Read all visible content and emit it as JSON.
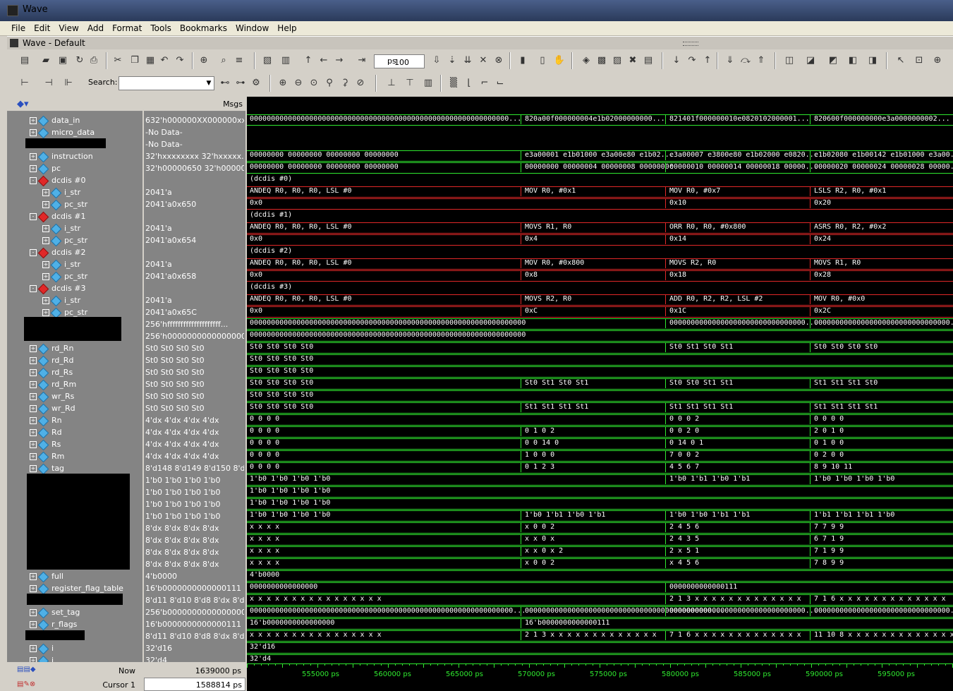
{
  "window": {
    "title": "Wave",
    "subtitle": "Wave - Default"
  },
  "menu": [
    "File",
    "Edit",
    "View",
    "Add",
    "Format",
    "Tools",
    "Bookmarks",
    "Window",
    "Help"
  ],
  "toolbar": {
    "zoom_value": "100",
    "zoom_unit": "ps",
    "search_label": "Search:"
  },
  "header": {
    "msgs": "Msgs"
  },
  "signals": [
    {
      "name": "data_in",
      "value": "632'h000000XX000000xx...",
      "icon": "blue",
      "exp": "+",
      "indent": 0
    },
    {
      "name": "micro_data",
      "value": "-No Data-",
      "icon": "blue",
      "exp": "+",
      "indent": 0
    },
    {
      "name": "",
      "value": "-No Data-",
      "icon": "",
      "exp": "",
      "indent": 0
    },
    {
      "name": "instruction",
      "value": "32'hxxxxxxxx 32'hxxxxx...",
      "icon": "blue",
      "exp": "+",
      "indent": 0
    },
    {
      "name": "pc",
      "value": "32'h00000650 32'h00000...",
      "icon": "blue",
      "exp": "+",
      "indent": 0
    },
    {
      "name": "dcdis #0",
      "value": "",
      "icon": "red",
      "exp": "-",
      "indent": 0
    },
    {
      "name": "i_str",
      "value": "2041'a",
      "icon": "blue",
      "exp": "+",
      "indent": 1
    },
    {
      "name": "pc_str",
      "value": "2041'a0x650",
      "icon": "blue",
      "exp": "+",
      "indent": 1
    },
    {
      "name": "dcdis #1",
      "value": "",
      "icon": "red",
      "exp": "-",
      "indent": 0
    },
    {
      "name": "i_str",
      "value": "2041'a",
      "icon": "blue",
      "exp": "+",
      "indent": 1
    },
    {
      "name": "pc_str",
      "value": "2041'a0x654",
      "icon": "blue",
      "exp": "+",
      "indent": 1
    },
    {
      "name": "dcdis #2",
      "value": "",
      "icon": "red",
      "exp": "-",
      "indent": 0
    },
    {
      "name": "i_str",
      "value": "2041'a",
      "icon": "blue",
      "exp": "+",
      "indent": 1
    },
    {
      "name": "pc_str",
      "value": "2041'a0x658",
      "icon": "blue",
      "exp": "+",
      "indent": 1
    },
    {
      "name": "dcdis #3",
      "value": "",
      "icon": "red",
      "exp": "-",
      "indent": 0
    },
    {
      "name": "i_str",
      "value": "2041'a",
      "icon": "blue",
      "exp": "+",
      "indent": 1
    },
    {
      "name": "pc_str",
      "value": "2041'a0x65C",
      "icon": "blue",
      "exp": "+",
      "indent": 1
    },
    {
      "name": "",
      "value": "256'hffffffffffffffffffff...",
      "icon": "",
      "exp": "",
      "indent": 0
    },
    {
      "name": "",
      "value": "256'h00000000000000000...",
      "icon": "",
      "exp": "",
      "indent": 0
    },
    {
      "name": "rd_Rn",
      "value": "St0 St0 St0 St0",
      "icon": "blue",
      "exp": "+",
      "indent": 0
    },
    {
      "name": "rd_Rd",
      "value": "St0 St0 St0 St0",
      "icon": "blue",
      "exp": "+",
      "indent": 0
    },
    {
      "name": "rd_Rs",
      "value": "St0 St0 St0 St0",
      "icon": "blue",
      "exp": "+",
      "indent": 0
    },
    {
      "name": "rd_Rm",
      "value": "St0 St0 St0 St0",
      "icon": "blue",
      "exp": "+",
      "indent": 0
    },
    {
      "name": "wr_Rs",
      "value": "St0 St0 St0 St0",
      "icon": "blue",
      "exp": "+",
      "indent": 0
    },
    {
      "name": "wr_Rd",
      "value": "St0 St0 St0 St0",
      "icon": "blue",
      "exp": "+",
      "indent": 0
    },
    {
      "name": "Rn",
      "value": "4'dx 4'dx 4'dx 4'dx",
      "icon": "blue",
      "exp": "+",
      "indent": 0
    },
    {
      "name": "Rd",
      "value": "4'dx 4'dx 4'dx 4'dx",
      "icon": "blue",
      "exp": "+",
      "indent": 0
    },
    {
      "name": "Rs",
      "value": "4'dx 4'dx 4'dx 4'dx",
      "icon": "blue",
      "exp": "+",
      "indent": 0
    },
    {
      "name": "Rm",
      "value": "4'dx 4'dx 4'dx 4'dx",
      "icon": "blue",
      "exp": "+",
      "indent": 0
    },
    {
      "name": "tag",
      "value": "8'd148 8'd149 8'd150 8'd151",
      "icon": "blue",
      "exp": "+",
      "indent": 0
    },
    {
      "name": "",
      "value": "1'b0 1'b0 1'b0 1'b0",
      "icon": "",
      "exp": "",
      "indent": 0
    },
    {
      "name": "",
      "value": "1'b0 1'b0 1'b0 1'b0",
      "icon": "",
      "exp": "",
      "indent": 0
    },
    {
      "name": "",
      "value": "1'b0 1'b0 1'b0 1'b0",
      "icon": "",
      "exp": "",
      "indent": 0
    },
    {
      "name": "",
      "value": "1'b0 1'b0 1'b0 1'b0",
      "icon": "",
      "exp": "",
      "indent": 0
    },
    {
      "name": "",
      "value": "8'dx 8'dx 8'dx 8'dx",
      "icon": "",
      "exp": "",
      "indent": 0
    },
    {
      "name": "",
      "value": "8'dx 8'dx 8'dx 8'dx",
      "icon": "",
      "exp": "",
      "indent": 0
    },
    {
      "name": "",
      "value": "8'dx 8'dx 8'dx 8'dx",
      "icon": "",
      "exp": "",
      "indent": 0
    },
    {
      "name": "",
      "value": "8'dx 8'dx 8'dx 8'dx",
      "icon": "",
      "exp": "",
      "indent": 0
    },
    {
      "name": "full",
      "value": "4'b0000",
      "icon": "blue",
      "exp": "+",
      "indent": 0
    },
    {
      "name": "register_flag_table",
      "value": "16'b0000000000000111",
      "icon": "blue",
      "exp": "+",
      "indent": 0
    },
    {
      "name": "",
      "value": "8'd11 8'd10 8'd8 8'dx 8'dx ...",
      "icon": "",
      "exp": "",
      "indent": 0
    },
    {
      "name": "set_tag",
      "value": "256'b000000000000000000...",
      "icon": "blue",
      "exp": "+",
      "indent": 0
    },
    {
      "name": "r_flags",
      "value": "16'b0000000000000111",
      "icon": "blue",
      "exp": "+",
      "indent": 0
    },
    {
      "name": "",
      "value": "8'd11 8'd10 8'd8 8'dx 8'dx ...",
      "icon": "",
      "exp": "",
      "indent": 0
    },
    {
      "name": "i",
      "value": "32'd16",
      "icon": "blue",
      "exp": "+",
      "indent": 0
    },
    {
      "name": "j",
      "value": "32'd4",
      "icon": "blue",
      "exp": "+",
      "indent": 0
    }
  ],
  "waves": [
    {
      "color": "green",
      "segs": [
        [
          "0000000000000000000000000000000000000000000000000000000000000...",
          0
        ],
        [
          "820a00f000000004e1b02000000000...",
          390
        ],
        [
          "821401f000000010e0820102000001...",
          595
        ],
        [
          "820600f000000000e3a0000000002...",
          800
        ]
      ]
    },
    {
      "color": "green",
      "segs": []
    },
    {
      "color": "green",
      "segs": []
    },
    {
      "color": "green",
      "segs": [
        [
          "00000000 00000000 00000000 00000000",
          0
        ],
        [
          "e3a00001 e1b01000 e3a00e80 e1b02...",
          390
        ],
        [
          "e3a00007 e3800e80 e1b02000 e0820...",
          595
        ],
        [
          "e1b02080 e1b00142 e1b01000 e3a00...",
          800
        ]
      ]
    },
    {
      "color": "green",
      "segs": [
        [
          "00000000 00000000 00000000 00000000",
          0
        ],
        [
          "00000000 00000004 00000008 0000000c",
          390
        ],
        [
          "00000010 00000014 00000018 00000...",
          595
        ],
        [
          "00000020 00000024 00000028 00000...",
          800
        ]
      ]
    },
    {
      "color": "none",
      "segs": [
        [
          "(dcdis #0)",
          0
        ]
      ]
    },
    {
      "color": "red",
      "segs": [
        [
          "ANDEQ R0, R0, R0, LSL #0",
          0
        ],
        [
          "MOV R0, #0x1",
          390
        ],
        [
          "MOV R0, #0x7",
          595
        ],
        [
          "LSLS R2, R0, #0x1",
          800
        ]
      ]
    },
    {
      "color": "red",
      "segs": [
        [
          "0x0",
          0
        ],
        [
          "0x10",
          595
        ],
        [
          "0x20",
          800
        ]
      ]
    },
    {
      "color": "none",
      "segs": [
        [
          "(dcdis #1)",
          0
        ]
      ]
    },
    {
      "color": "red",
      "segs": [
        [
          "ANDEQ R0, R0, R0, LSL #0",
          0
        ],
        [
          "MOVS R1, R0",
          390
        ],
        [
          "ORR R0, R0, #0x800",
          595
        ],
        [
          "ASRS R0, R2, #0x2",
          800
        ]
      ]
    },
    {
      "color": "red",
      "segs": [
        [
          "0x0",
          0
        ],
        [
          "0x4",
          390
        ],
        [
          "0x14",
          595
        ],
        [
          "0x24",
          800
        ]
      ]
    },
    {
      "color": "none",
      "segs": [
        [
          "(dcdis #2)",
          0
        ]
      ]
    },
    {
      "color": "red",
      "segs": [
        [
          "ANDEQ R0, R0, R0, LSL #0",
          0
        ],
        [
          "MOV R0, #0x800",
          390
        ],
        [
          "MOVS R2, R0",
          595
        ],
        [
          "MOVS R1, R0",
          800
        ]
      ]
    },
    {
      "color": "red",
      "segs": [
        [
          "0x0",
          0
        ],
        [
          "0x8",
          390
        ],
        [
          "0x18",
          595
        ],
        [
          "0x28",
          800
        ]
      ]
    },
    {
      "color": "none",
      "segs": [
        [
          "(dcdis #3)",
          0
        ]
      ]
    },
    {
      "color": "red",
      "segs": [
        [
          "ANDEQ R0, R0, R0, LSL #0",
          0
        ],
        [
          "MOVS R2, R0",
          390
        ],
        [
          "ADD R0, R2, R2, LSL #2",
          595
        ],
        [
          "MOV R0, #0x0",
          800
        ]
      ]
    },
    {
      "color": "red",
      "segs": [
        [
          "0x0",
          0
        ],
        [
          "0xC",
          390
        ],
        [
          "0x1C",
          595
        ],
        [
          "0x2C",
          800
        ]
      ]
    },
    {
      "color": "green",
      "segs": [
        [
          "00000000000000000000000000000000000000000000000000000000000000000",
          0
        ],
        [
          "00000000000000000000000000000000...",
          595
        ],
        [
          "00000000000000000000000000000000...",
          800
        ]
      ]
    },
    {
      "color": "green",
      "segs": [
        [
          "00000000000000000000000000000000000000000000000000000000000000000",
          0
        ]
      ]
    },
    {
      "color": "green",
      "segs": [
        [
          "St0 St0 St0 St0",
          0
        ],
        [
          "St0 St1 St0 St1",
          595
        ],
        [
          "St0 St0 St0 St0",
          800
        ]
      ]
    },
    {
      "color": "green",
      "segs": [
        [
          "St0 St0 St0 St0",
          0
        ]
      ]
    },
    {
      "color": "green",
      "segs": [
        [
          "St0 St0 St0 St0",
          0
        ]
      ]
    },
    {
      "color": "green",
      "segs": [
        [
          "St0 St0 St0 St0",
          0
        ],
        [
          "St0 St1 St0 St1",
          390
        ],
        [
          "St0 St0 St1 St1",
          595
        ],
        [
          "St1 St1 St1 St0",
          800
        ]
      ]
    },
    {
      "color": "green",
      "segs": [
        [
          "St0 St0 St0 St0",
          0
        ]
      ]
    },
    {
      "color": "green",
      "segs": [
        [
          "St0 St0 St0 St0",
          0
        ],
        [
          "St1 St1 St1 St1",
          390
        ],
        [
          "St1 St1 St1 St1",
          595
        ],
        [
          "St1 St1 St1 St1",
          800
        ]
      ]
    },
    {
      "color": "green",
      "segs": [
        [
          "0 0 0 0",
          0
        ],
        [
          "0 0 0 2",
          595
        ],
        [
          "0 0 0 0",
          800
        ]
      ]
    },
    {
      "color": "green",
      "segs": [
        [
          "0 0 0 0",
          0
        ],
        [
          "0 1 0 2",
          390
        ],
        [
          "0 0 2 0",
          595
        ],
        [
          "2 0 1 0",
          800
        ]
      ]
    },
    {
      "color": "green",
      "segs": [
        [
          "0 0 0 0",
          0
        ],
        [
          "0 0 14 0",
          390
        ],
        [
          "0 14 0 1",
          595
        ],
        [
          "0 1 0 0",
          800
        ]
      ]
    },
    {
      "color": "green",
      "segs": [
        [
          "0 0 0 0",
          0
        ],
        [
          "1 0 0 0",
          390
        ],
        [
          "7 0 0 2",
          595
        ],
        [
          "0 2 0 0",
          800
        ]
      ]
    },
    {
      "color": "green",
      "segs": [
        [
          "0 0 0 0",
          0
        ],
        [
          "0 1 2 3",
          390
        ],
        [
          "4 5 6 7",
          595
        ],
        [
          "8 9 10 11",
          800
        ]
      ]
    },
    {
      "color": "green",
      "segs": [
        [
          "1'b0 1'b0 1'b0 1'b0",
          0
        ],
        [
          "1'b0 1'b1 1'b0 1'b1",
          595
        ],
        [
          "1'b0 1'b0 1'b0 1'b0",
          800
        ]
      ]
    },
    {
      "color": "green",
      "segs": [
        [
          "1'b0 1'b0 1'b0 1'b0",
          0
        ]
      ]
    },
    {
      "color": "green",
      "segs": [
        [
          "1'b0 1'b0 1'b0 1'b0",
          0
        ]
      ]
    },
    {
      "color": "green",
      "segs": [
        [
          "1'b0 1'b0 1'b0 1'b0",
          0
        ],
        [
          "1'b0 1'b1 1'b0 1'b1",
          390
        ],
        [
          "1'b0 1'b0 1'b1 1'b1",
          595
        ],
        [
          "1'b1 1'b1 1'b1 1'b0",
          800
        ]
      ]
    },
    {
      "color": "green",
      "segs": [
        [
          "x x x x",
          0
        ],
        [
          "x 0 0 2",
          390
        ],
        [
          "2 4 5 6",
          595
        ],
        [
          "7 7 9 9",
          800
        ]
      ]
    },
    {
      "color": "green",
      "segs": [
        [
          "x x x x",
          0
        ],
        [
          "x x 0 x",
          390
        ],
        [
          "2 4 3 5",
          595
        ],
        [
          "6 7 1 9",
          800
        ]
      ]
    },
    {
      "color": "green",
      "segs": [
        [
          "x x x x",
          0
        ],
        [
          "x x 0 x 2",
          390
        ],
        [
          "2 x 5 1",
          595
        ],
        [
          "7 1 9 9",
          800
        ]
      ]
    },
    {
      "color": "green",
      "segs": [
        [
          "x x x x",
          0
        ],
        [
          "x 0 0 2",
          390
        ],
        [
          "x 4 5 6",
          595
        ],
        [
          "7 8 9 9",
          800
        ]
      ]
    },
    {
      "color": "green",
      "segs": [
        [
          "4'b0000",
          0
        ]
      ]
    },
    {
      "color": "green",
      "segs": [
        [
          "0000000000000000",
          0
        ],
        [
          "0000000000000111",
          595
        ]
      ]
    },
    {
      "color": "green",
      "segs": [
        [
          "x x x x x x x x x x x x x x x x",
          0
        ],
        [
          "2 1 3 x x x x x x x x x x x x x",
          595
        ],
        [
          "7 1 6 x x x x x x x x x x x x x",
          800
        ]
      ]
    },
    {
      "color": "green",
      "segs": [
        [
          "00000000000000000000000000000000000000000000000000000000000000...",
          0
        ],
        [
          "00000000000000000000000000000000000000000000...",
          390
        ],
        [
          "00000000000000000000000000000000...",
          595
        ],
        [
          "00000000000000000000000000000000...",
          800
        ]
      ]
    },
    {
      "color": "green",
      "segs": [
        [
          "16'b0000000000000000",
          0
        ],
        [
          "16'b0000000000000111",
          390
        ]
      ]
    },
    {
      "color": "green",
      "segs": [
        [
          "x x x x x x x x x x x x x x x x",
          0
        ],
        [
          "2 1 3 x x x x x x x x x x x x x",
          390
        ],
        [
          "7 1 6 x x x x x x x x x x x x x",
          595
        ],
        [
          "11 10 8 x x x x x x x x x x x x x",
          800
        ]
      ]
    },
    {
      "color": "green",
      "segs": [
        [
          "32'd16",
          0
        ]
      ]
    },
    {
      "color": "green",
      "segs": [
        [
          "32'd4",
          0
        ]
      ]
    }
  ],
  "footer": {
    "now_label": "Now",
    "now_value": "1639000 ps",
    "cursor_label": "Cursor 1",
    "cursor_value": "1588814 ps"
  },
  "timescale": [
    "555000 ps",
    "560000 ps",
    "565000 ps",
    "570000 ps",
    "575000 ps",
    "580000 ps",
    "585000 ps",
    "590000 ps",
    "595000 ps"
  ]
}
